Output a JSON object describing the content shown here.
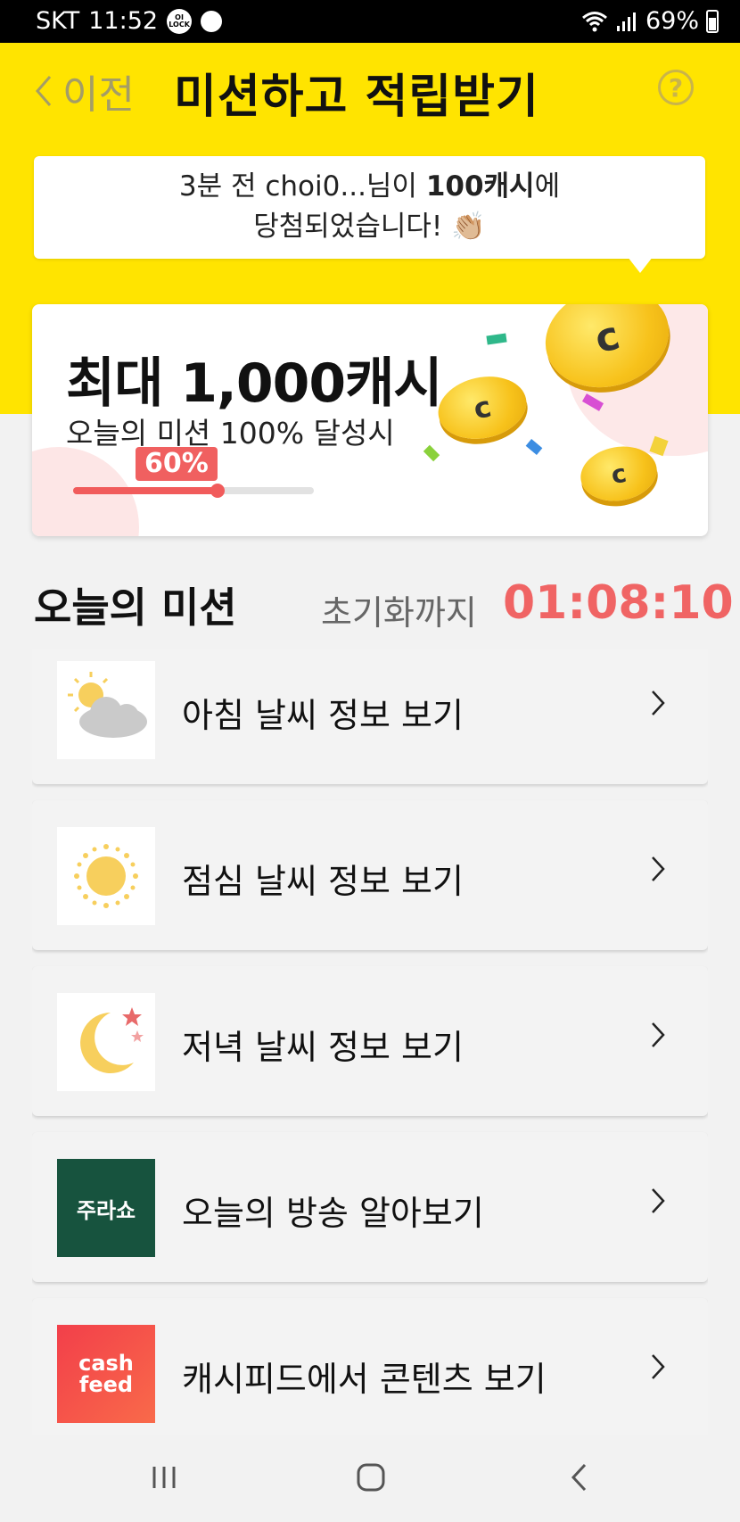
{
  "status_bar": {
    "carrier": "SKT",
    "time": "11:52",
    "lock_badge": "OI LOCK",
    "battery_percent": "69%"
  },
  "header": {
    "back_label": "이전",
    "title": "미션하고 적립받기",
    "help_label": "?"
  },
  "toast": {
    "line1_prefix": "3분 전 choi0...님이 ",
    "line1_bold": "100캐시",
    "line1_suffix": "에",
    "line2": "당첨되었습니다! 👏🏼"
  },
  "reward": {
    "title": "최대 1,000캐시",
    "subtitle": "오늘의 미션 100% 달성시",
    "progress_label": "60%",
    "progress_value": 0.6
  },
  "missions_section": {
    "title": "오늘의 미션",
    "timer_label": "초기화까지",
    "timer_value": "01:08:10"
  },
  "missions": [
    {
      "label": "아침 날씨 정보 보기",
      "icon": "morning-weather-icon"
    },
    {
      "label": "점심 날씨 정보 보기",
      "icon": "sun-icon"
    },
    {
      "label": "저녁 날씨 정보 보기",
      "icon": "moon-icon"
    },
    {
      "label": "오늘의 방송 알아보기",
      "icon": "jurasho-logo",
      "logo_text": "주라쇼"
    },
    {
      "label": "캐시피드에서 콘텐츠 보기",
      "icon": "cashfeed-logo",
      "logo_line1": "cash",
      "logo_line2": "feed"
    }
  ],
  "colors": {
    "brand_yellow": "#ffe400",
    "accent_red": "#f06464",
    "jurasho_green": "#17533e",
    "cashfeed_red": "#f23f4a"
  }
}
